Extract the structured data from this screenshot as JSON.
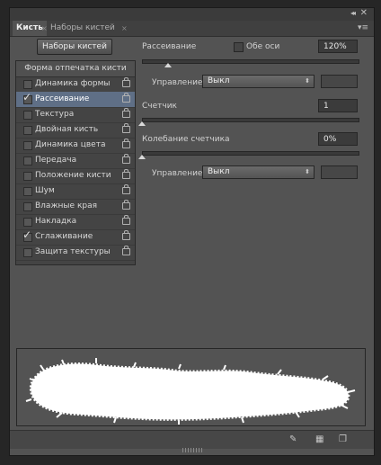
{
  "header": {
    "collapse_glyph": "◂◂",
    "close_glyph": "✕"
  },
  "tabs": {
    "brush": "Кисть",
    "presets": "Наборы кистей",
    "close_glyph": "×",
    "menu_glyph": "▾≡"
  },
  "presets_button": "Наборы кистей",
  "sidebar": {
    "header": "Форма отпечатка кисти",
    "items": [
      {
        "label": "Динамика формы",
        "checked": false,
        "selected": false
      },
      {
        "label": "Рассеивание",
        "checked": true,
        "selected": true
      },
      {
        "label": "Текстура",
        "checked": false,
        "selected": false
      },
      {
        "label": "Двойная кисть",
        "checked": false,
        "selected": false
      },
      {
        "label": "Динамика цвета",
        "checked": false,
        "selected": false
      },
      {
        "label": "Передача",
        "checked": false,
        "selected": false
      },
      {
        "label": "Положение кисти",
        "checked": false,
        "selected": false
      },
      {
        "label": "Шум",
        "checked": false,
        "selected": false
      },
      {
        "label": "Влажные края",
        "checked": false,
        "selected": false
      },
      {
        "label": "Накладка",
        "checked": false,
        "selected": false
      },
      {
        "label": "Сглаживание",
        "checked": true,
        "selected": false
      },
      {
        "label": "Защита текстуры",
        "checked": false,
        "selected": false
      }
    ],
    "check_glyph": "✓"
  },
  "scatter": {
    "label": "Рассеивание",
    "both_axes_label": "Обе оси",
    "value": "120%",
    "level": 0.12,
    "control_label": "Управление:",
    "control_value": "Выкл"
  },
  "count": {
    "label": "Счетчик",
    "value": "1",
    "level": 0.0
  },
  "count_jitter": {
    "label": "Колебание счетчика",
    "value": "0%",
    "level": 0.0,
    "control_label": "Управление:",
    "control_value": "Выкл"
  },
  "dropdown_arrow": "⬍",
  "bottom_icons": [
    "brush-tip-icon",
    "grid-icon",
    "new-preset-icon"
  ],
  "bottom_glyphs": {
    "brush": "✎",
    "grid": "▦",
    "new": "❐"
  }
}
